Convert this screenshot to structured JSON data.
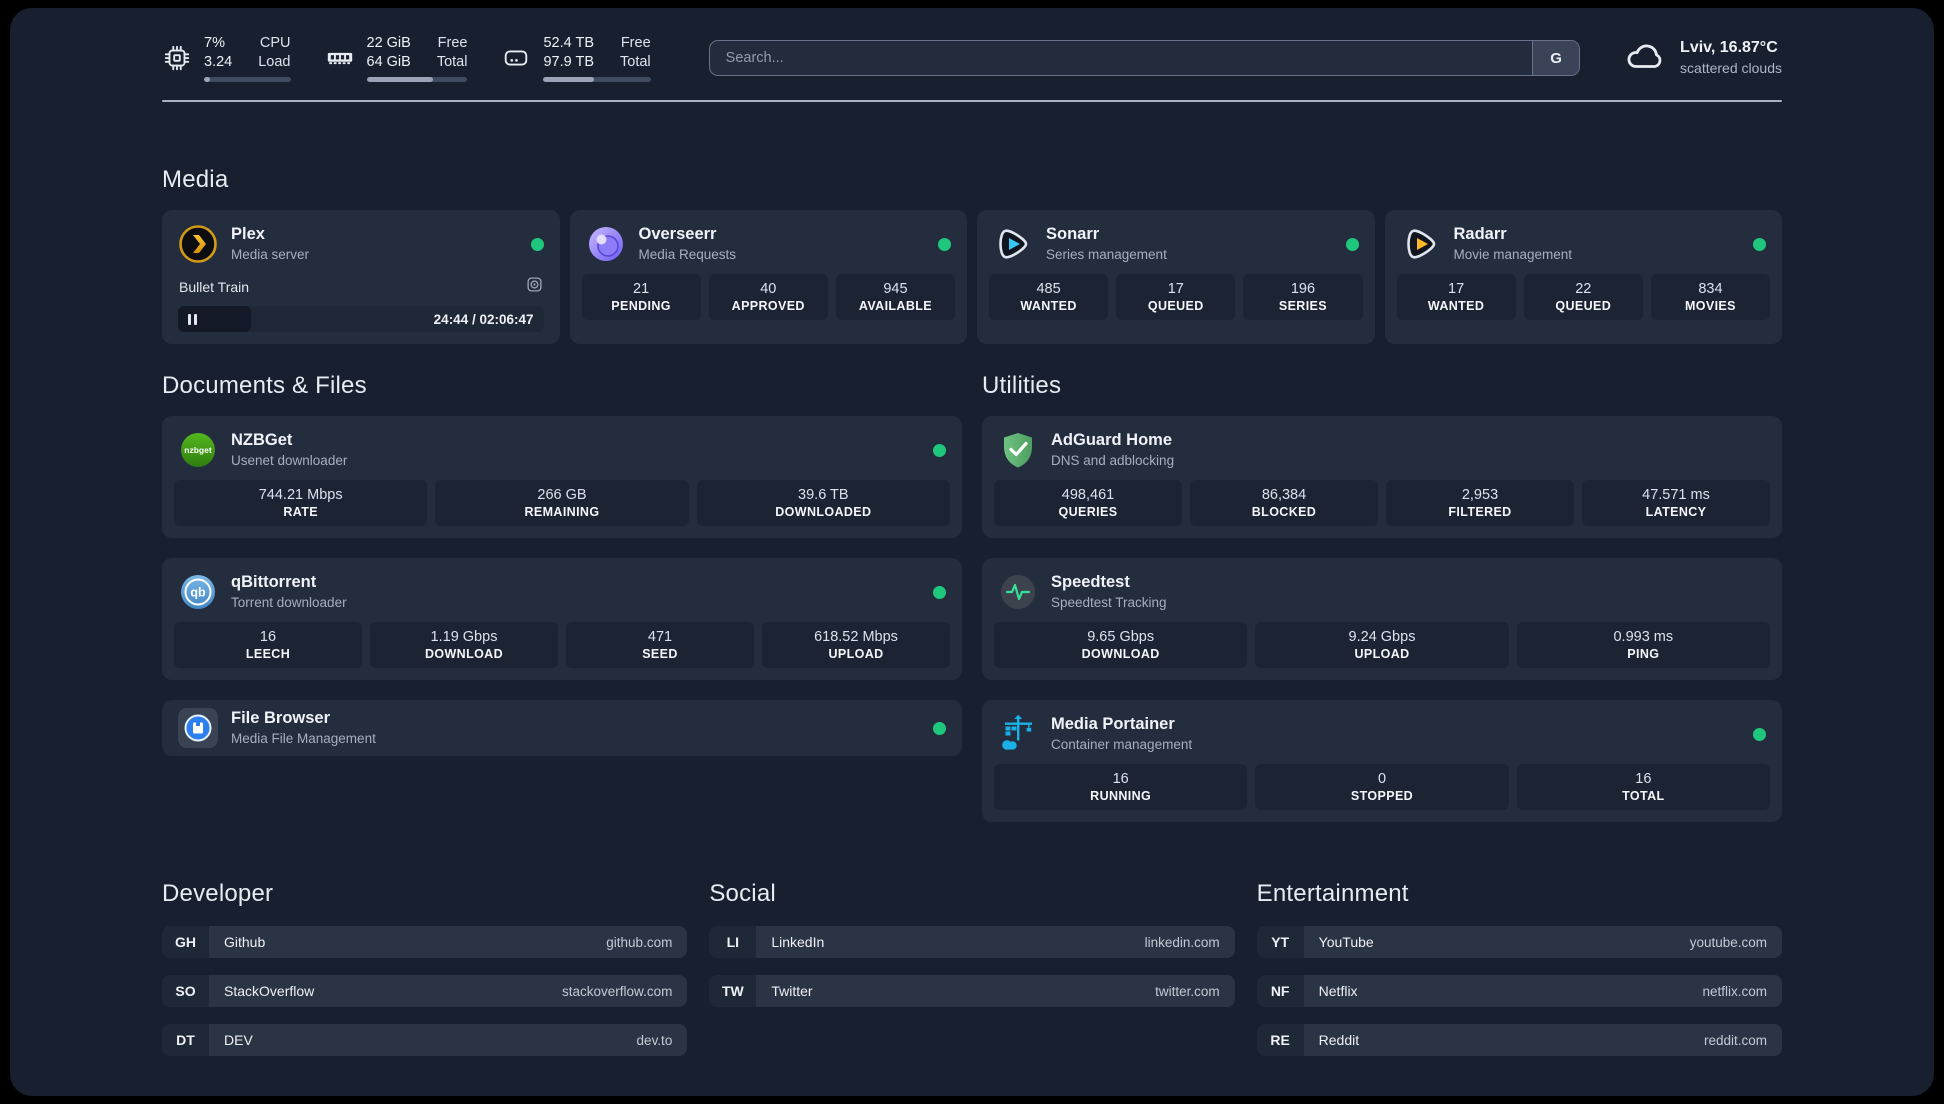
{
  "colors": {
    "status_online": "#1fc77d",
    "page_background": "#18202f",
    "card_background": "#242d3d",
    "stat_background": "#1c2433"
  },
  "topbar": {
    "cpu": {
      "v1": "7%",
      "v2": "3.24",
      "l1": "CPU",
      "l2": "Load",
      "progress_pct": 7
    },
    "ram": {
      "v1": "22 GiB",
      "v2": "64 GiB",
      "l1": "Free",
      "l2": "Total",
      "progress_pct": 66
    },
    "disk": {
      "v1": "52.4 TB",
      "v2": "97.9 TB",
      "l1": "Free",
      "l2": "Total",
      "progress_pct": 47
    },
    "search": {
      "placeholder": "Search...",
      "button_label": "G"
    },
    "weather": {
      "location": "Lviv, 16.87°C",
      "condition": "scattered clouds"
    }
  },
  "media": {
    "title": "Media",
    "cards": [
      {
        "name": "Plex",
        "desc": "Media server",
        "online": true,
        "player": {
          "title": "Bullet Train",
          "time": "24:44 / 02:06:47",
          "progress_pct": 20
        }
      },
      {
        "name": "Overseerr",
        "desc": "Media Requests",
        "online": true,
        "stats": [
          {
            "value": "21",
            "label": "PENDING"
          },
          {
            "value": "40",
            "label": "APPROVED"
          },
          {
            "value": "945",
            "label": "AVAILABLE"
          }
        ]
      },
      {
        "name": "Sonarr",
        "desc": "Series management",
        "online": true,
        "stats": [
          {
            "value": "485",
            "label": "WANTED"
          },
          {
            "value": "17",
            "label": "QUEUED"
          },
          {
            "value": "196",
            "label": "SERIES"
          }
        ]
      },
      {
        "name": "Radarr",
        "desc": "Movie management",
        "online": true,
        "stats": [
          {
            "value": "17",
            "label": "WANTED"
          },
          {
            "value": "22",
            "label": "QUEUED"
          },
          {
            "value": "834",
            "label": "MOVIES"
          }
        ]
      }
    ]
  },
  "documents": {
    "title": "Documents & Files",
    "cards": [
      {
        "name": "NZBGet",
        "desc": "Usenet downloader",
        "online": true,
        "stats": [
          {
            "value": "744.21 Mbps",
            "label": "RATE"
          },
          {
            "value": "266 GB",
            "label": "REMAINING"
          },
          {
            "value": "39.6 TB",
            "label": "DOWNLOADED"
          }
        ]
      },
      {
        "name": "qBittorrent",
        "desc": "Torrent downloader",
        "online": true,
        "stats": [
          {
            "value": "16",
            "label": "LEECH"
          },
          {
            "value": "1.19 Gbps",
            "label": "DOWNLOAD"
          },
          {
            "value": "471",
            "label": "SEED"
          },
          {
            "value": "618.52 Mbps",
            "label": "UPLOAD"
          }
        ]
      },
      {
        "name": "File Browser",
        "desc": "Media File Management",
        "online": true
      }
    ]
  },
  "utilities": {
    "title": "Utilities",
    "cards": [
      {
        "name": "AdGuard Home",
        "desc": "DNS and adblocking",
        "online": false,
        "stats": [
          {
            "value": "498,461",
            "label": "QUERIES"
          },
          {
            "value": "86,384",
            "label": "BLOCKED"
          },
          {
            "value": "2,953",
            "label": "FILTERED"
          },
          {
            "value": "47.571 ms",
            "label": "LATENCY"
          }
        ]
      },
      {
        "name": "Speedtest",
        "desc": "Speedtest Tracking",
        "online": false,
        "stats": [
          {
            "value": "9.65 Gbps",
            "label": "DOWNLOAD"
          },
          {
            "value": "9.24 Gbps",
            "label": "UPLOAD"
          },
          {
            "value": "0.993 ms",
            "label": "PING"
          }
        ]
      },
      {
        "name": "Media Portainer",
        "desc": "Container management",
        "online": true,
        "stats": [
          {
            "value": "16",
            "label": "RUNNING"
          },
          {
            "value": "0",
            "label": "STOPPED"
          },
          {
            "value": "16",
            "label": "TOTAL"
          }
        ]
      }
    ]
  },
  "bookmarks": [
    {
      "title": "Developer",
      "links": [
        {
          "abbr": "GH",
          "name": "Github",
          "url": "github.com"
        },
        {
          "abbr": "SO",
          "name": "StackOverflow",
          "url": "stackoverflow.com"
        },
        {
          "abbr": "DT",
          "name": "DEV",
          "url": "dev.to"
        }
      ]
    },
    {
      "title": "Social",
      "links": [
        {
          "abbr": "LI",
          "name": "LinkedIn",
          "url": "linkedin.com"
        },
        {
          "abbr": "TW",
          "name": "Twitter",
          "url": "twitter.com"
        }
      ]
    },
    {
      "title": "Entertainment",
      "links": [
        {
          "abbr": "YT",
          "name": "YouTube",
          "url": "youtube.com"
        },
        {
          "abbr": "NF",
          "name": "Netflix",
          "url": "netflix.com"
        },
        {
          "abbr": "RE",
          "name": "Reddit",
          "url": "reddit.com"
        }
      ]
    }
  ]
}
